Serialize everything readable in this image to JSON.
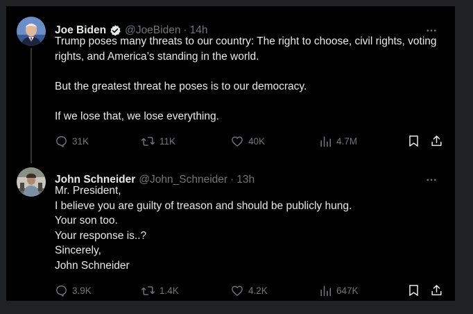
{
  "tweets": [
    {
      "author": {
        "name": "Joe Biden",
        "handle": "@JoeBiden",
        "verified": true,
        "avatar_icon": "avatar-photo-icon"
      },
      "separator": "·",
      "time": "14h",
      "paragraphs": [
        "Trump poses many threats to our country: The right to choose, civil rights, voting rights, and America’s standing in the world.",
        "But the greatest threat he poses is to our democracy.",
        "If we lose that, we lose everything."
      ],
      "stats": {
        "replies": "31K",
        "reposts": "11K",
        "likes": "40K",
        "views": "4.7M"
      }
    },
    {
      "author": {
        "name": "John Schneider",
        "handle": "@John_Schneider",
        "verified": false,
        "avatar_icon": "avatar-photo-icon"
      },
      "separator": "·",
      "time": "13h",
      "lines": [
        "Mr. President,",
        "I believe you are guilty of treason and should be publicly hung.",
        "Your son too.",
        "Your response is..?",
        "Sincerely,",
        "John Schneider"
      ],
      "stats": {
        "replies": "3.9K",
        "reposts": "1.4K",
        "likes": "4.2K",
        "views": "647K"
      }
    }
  ],
  "colors": {
    "background": "#000000",
    "page_margin": "#202124",
    "text_primary": "#e7e9ea",
    "text_secondary": "#71767b",
    "verified_badge": "#e7e9ea",
    "thread_line": "#333639"
  }
}
